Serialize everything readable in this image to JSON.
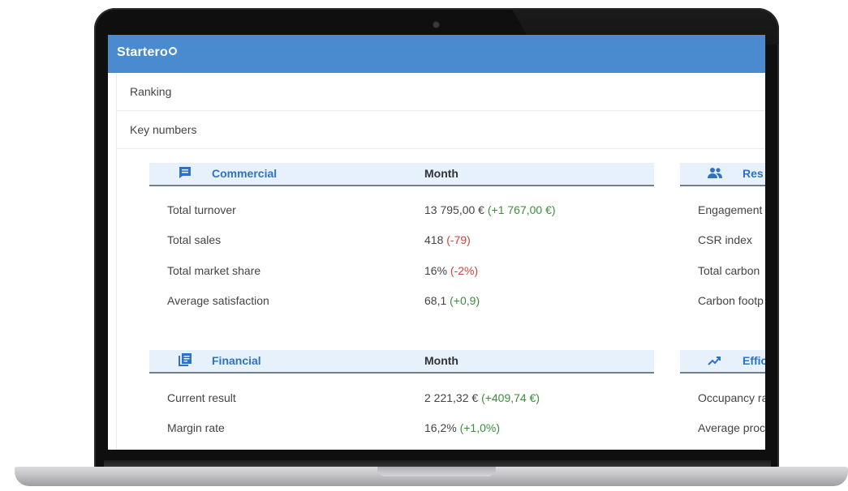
{
  "app": {
    "name": "Startero"
  },
  "nav": [
    {
      "label": "Ranking"
    },
    {
      "label": "Key numbers"
    }
  ],
  "colors": {
    "header": "#4a8bd0",
    "accent": "#2f72c4",
    "positive": "#3a8d3a",
    "negative": "#c9463c"
  },
  "sections": {
    "commercial": {
      "title": "Commercial",
      "icon": "chat-icon",
      "column": "Month",
      "rows": [
        {
          "label": "Total turnover",
          "value": "13 795,00 €",
          "delta": "(+1 767,00 €)",
          "trend": "positive"
        },
        {
          "label": "Total sales",
          "value": "418",
          "delta": "(-79)",
          "trend": "negative"
        },
        {
          "label": "Total market share",
          "value": "16%",
          "delta": "(-2%)",
          "trend": "negative"
        },
        {
          "label": "Average satisfaction",
          "value": "68,1",
          "delta": "(+0,9)",
          "trend": "positive"
        }
      ]
    },
    "responsibility": {
      "title": "Res",
      "icon": "people-icon",
      "rows": [
        {
          "label": "Engagement"
        },
        {
          "label": "CSR index"
        },
        {
          "label": "Total carbon"
        },
        {
          "label": "Carbon footp"
        }
      ]
    },
    "financial": {
      "title": "Financial",
      "icon": "document-icon",
      "column": "Month",
      "rows": [
        {
          "label": "Current result",
          "value": "2 221,32 €",
          "delta": "(+409,74 €)",
          "trend": "positive"
        },
        {
          "label": "Margin rate",
          "value": "16,2%",
          "delta": "(+1,0%)",
          "trend": "positive"
        }
      ]
    },
    "efficiency": {
      "title": "Effic",
      "icon": "trend-up-icon",
      "rows": [
        {
          "label": "Occupancy ra"
        },
        {
          "label": "Average proc"
        }
      ]
    }
  }
}
